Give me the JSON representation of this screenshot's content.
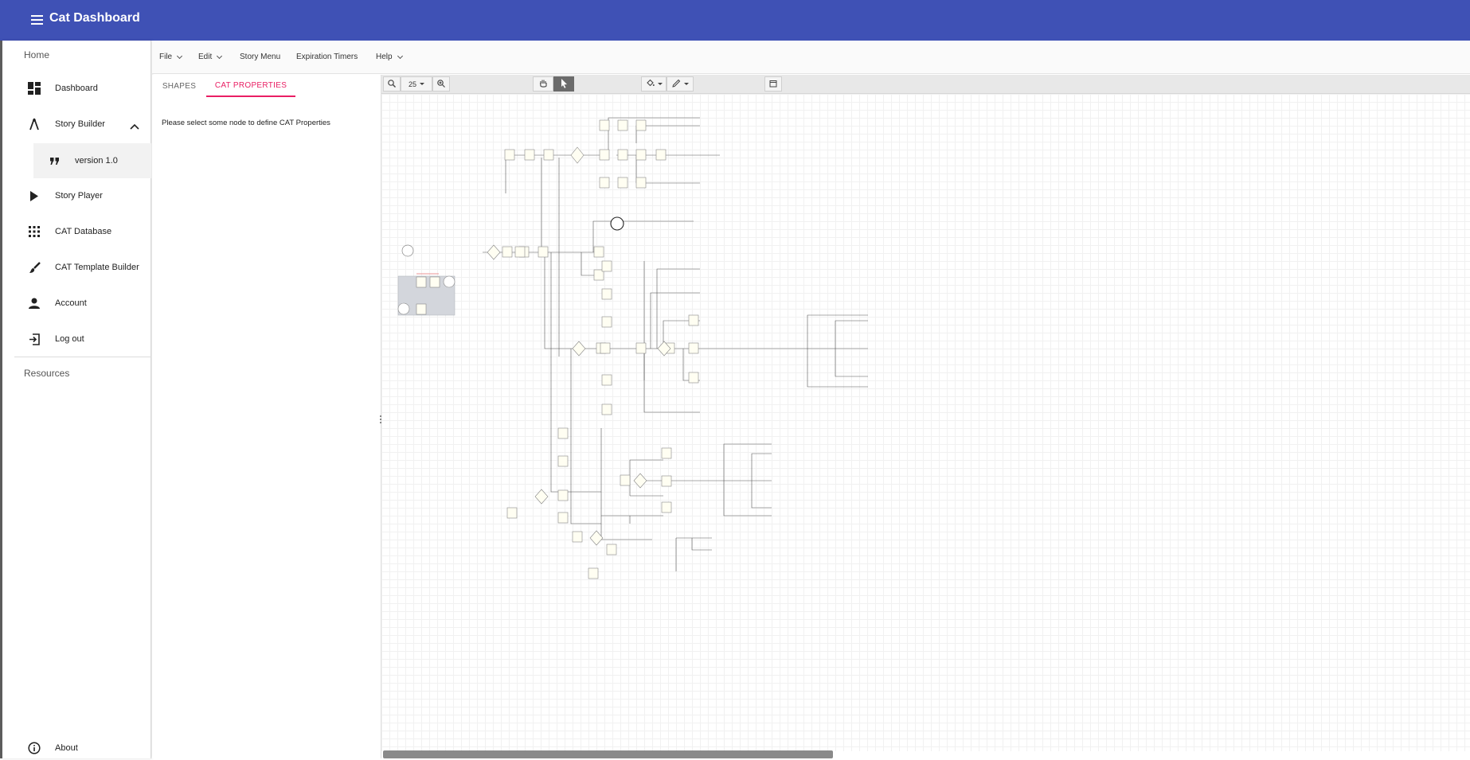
{
  "app": {
    "title": "Cat Dashboard"
  },
  "sidebar": {
    "home_label": "Home",
    "resources_label": "Resources",
    "items": [
      {
        "label": "Dashboard",
        "icon": "dashboard-icon"
      },
      {
        "label": "Story Builder",
        "icon": "compass-icon",
        "expanded": true
      },
      {
        "label": "version 1.0",
        "icon": "quote-icon",
        "selected": true
      },
      {
        "label": "Story Player",
        "icon": "play-icon"
      },
      {
        "label": "CAT Database",
        "icon": "apps-grid-icon"
      },
      {
        "label": "CAT Template Builder",
        "icon": "brush-icon"
      },
      {
        "label": "Account",
        "icon": "person-icon"
      },
      {
        "label": "Log out",
        "icon": "logout-icon"
      }
    ],
    "about_label": "About"
  },
  "menubar": {
    "file": "File",
    "edit": "Edit",
    "story_menu": "Story Menu",
    "expiration_timers": "Expiration Timers",
    "help": "Help"
  },
  "panel": {
    "tabs": [
      {
        "label": "SHAPES"
      },
      {
        "label": "CAT PROPERTIES",
        "active": true
      }
    ],
    "message": "Please select some node to define CAT Properties"
  },
  "toolbar": {
    "zoom_value": "25"
  },
  "colors": {
    "appbar": "#3f51b5",
    "accent": "#e91e63"
  }
}
